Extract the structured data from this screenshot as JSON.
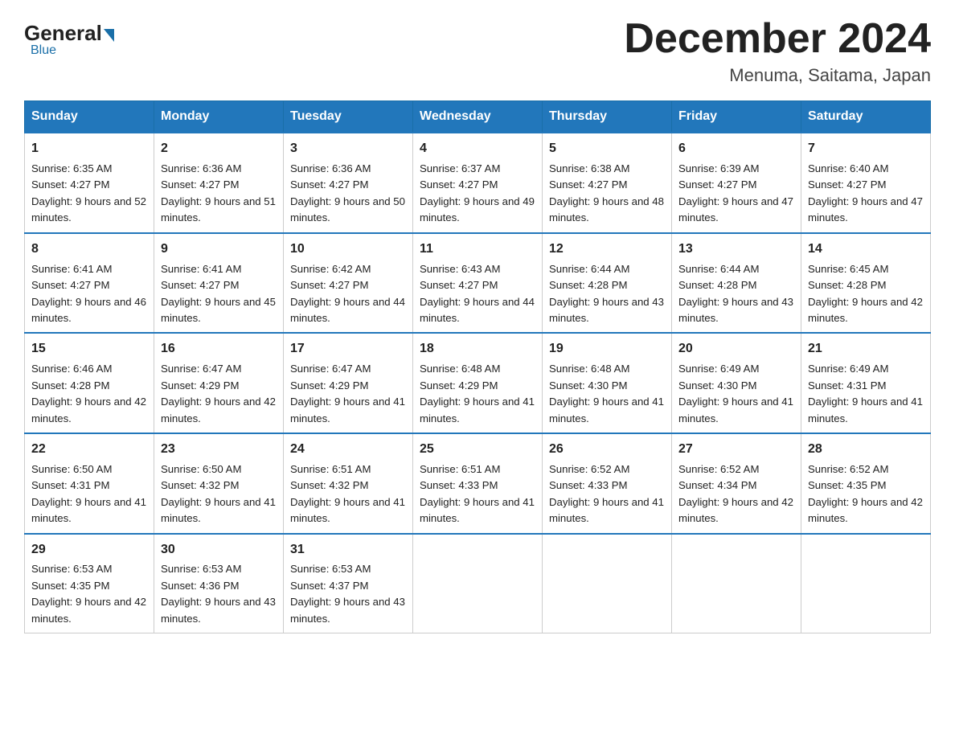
{
  "header": {
    "logo_general": "General",
    "logo_blue": "Blue",
    "month_title": "December 2024",
    "location": "Menuma, Saitama, Japan"
  },
  "days_of_week": [
    "Sunday",
    "Monday",
    "Tuesday",
    "Wednesday",
    "Thursday",
    "Friday",
    "Saturday"
  ],
  "weeks": [
    [
      {
        "day": 1,
        "sunrise": "6:35 AM",
        "sunset": "4:27 PM",
        "daylight": "9 hours and 52 minutes."
      },
      {
        "day": 2,
        "sunrise": "6:36 AM",
        "sunset": "4:27 PM",
        "daylight": "9 hours and 51 minutes."
      },
      {
        "day": 3,
        "sunrise": "6:36 AM",
        "sunset": "4:27 PM",
        "daylight": "9 hours and 50 minutes."
      },
      {
        "day": 4,
        "sunrise": "6:37 AM",
        "sunset": "4:27 PM",
        "daylight": "9 hours and 49 minutes."
      },
      {
        "day": 5,
        "sunrise": "6:38 AM",
        "sunset": "4:27 PM",
        "daylight": "9 hours and 48 minutes."
      },
      {
        "day": 6,
        "sunrise": "6:39 AM",
        "sunset": "4:27 PM",
        "daylight": "9 hours and 47 minutes."
      },
      {
        "day": 7,
        "sunrise": "6:40 AM",
        "sunset": "4:27 PM",
        "daylight": "9 hours and 47 minutes."
      }
    ],
    [
      {
        "day": 8,
        "sunrise": "6:41 AM",
        "sunset": "4:27 PM",
        "daylight": "9 hours and 46 minutes."
      },
      {
        "day": 9,
        "sunrise": "6:41 AM",
        "sunset": "4:27 PM",
        "daylight": "9 hours and 45 minutes."
      },
      {
        "day": 10,
        "sunrise": "6:42 AM",
        "sunset": "4:27 PM",
        "daylight": "9 hours and 44 minutes."
      },
      {
        "day": 11,
        "sunrise": "6:43 AM",
        "sunset": "4:27 PM",
        "daylight": "9 hours and 44 minutes."
      },
      {
        "day": 12,
        "sunrise": "6:44 AM",
        "sunset": "4:28 PM",
        "daylight": "9 hours and 43 minutes."
      },
      {
        "day": 13,
        "sunrise": "6:44 AM",
        "sunset": "4:28 PM",
        "daylight": "9 hours and 43 minutes."
      },
      {
        "day": 14,
        "sunrise": "6:45 AM",
        "sunset": "4:28 PM",
        "daylight": "9 hours and 42 minutes."
      }
    ],
    [
      {
        "day": 15,
        "sunrise": "6:46 AM",
        "sunset": "4:28 PM",
        "daylight": "9 hours and 42 minutes."
      },
      {
        "day": 16,
        "sunrise": "6:47 AM",
        "sunset": "4:29 PM",
        "daylight": "9 hours and 42 minutes."
      },
      {
        "day": 17,
        "sunrise": "6:47 AM",
        "sunset": "4:29 PM",
        "daylight": "9 hours and 41 minutes."
      },
      {
        "day": 18,
        "sunrise": "6:48 AM",
        "sunset": "4:29 PM",
        "daylight": "9 hours and 41 minutes."
      },
      {
        "day": 19,
        "sunrise": "6:48 AM",
        "sunset": "4:30 PM",
        "daylight": "9 hours and 41 minutes."
      },
      {
        "day": 20,
        "sunrise": "6:49 AM",
        "sunset": "4:30 PM",
        "daylight": "9 hours and 41 minutes."
      },
      {
        "day": 21,
        "sunrise": "6:49 AM",
        "sunset": "4:31 PM",
        "daylight": "9 hours and 41 minutes."
      }
    ],
    [
      {
        "day": 22,
        "sunrise": "6:50 AM",
        "sunset": "4:31 PM",
        "daylight": "9 hours and 41 minutes."
      },
      {
        "day": 23,
        "sunrise": "6:50 AM",
        "sunset": "4:32 PM",
        "daylight": "9 hours and 41 minutes."
      },
      {
        "day": 24,
        "sunrise": "6:51 AM",
        "sunset": "4:32 PM",
        "daylight": "9 hours and 41 minutes."
      },
      {
        "day": 25,
        "sunrise": "6:51 AM",
        "sunset": "4:33 PM",
        "daylight": "9 hours and 41 minutes."
      },
      {
        "day": 26,
        "sunrise": "6:52 AM",
        "sunset": "4:33 PM",
        "daylight": "9 hours and 41 minutes."
      },
      {
        "day": 27,
        "sunrise": "6:52 AM",
        "sunset": "4:34 PM",
        "daylight": "9 hours and 42 minutes."
      },
      {
        "day": 28,
        "sunrise": "6:52 AM",
        "sunset": "4:35 PM",
        "daylight": "9 hours and 42 minutes."
      }
    ],
    [
      {
        "day": 29,
        "sunrise": "6:53 AM",
        "sunset": "4:35 PM",
        "daylight": "9 hours and 42 minutes."
      },
      {
        "day": 30,
        "sunrise": "6:53 AM",
        "sunset": "4:36 PM",
        "daylight": "9 hours and 43 minutes."
      },
      {
        "day": 31,
        "sunrise": "6:53 AM",
        "sunset": "4:37 PM",
        "daylight": "9 hours and 43 minutes."
      },
      null,
      null,
      null,
      null
    ]
  ]
}
